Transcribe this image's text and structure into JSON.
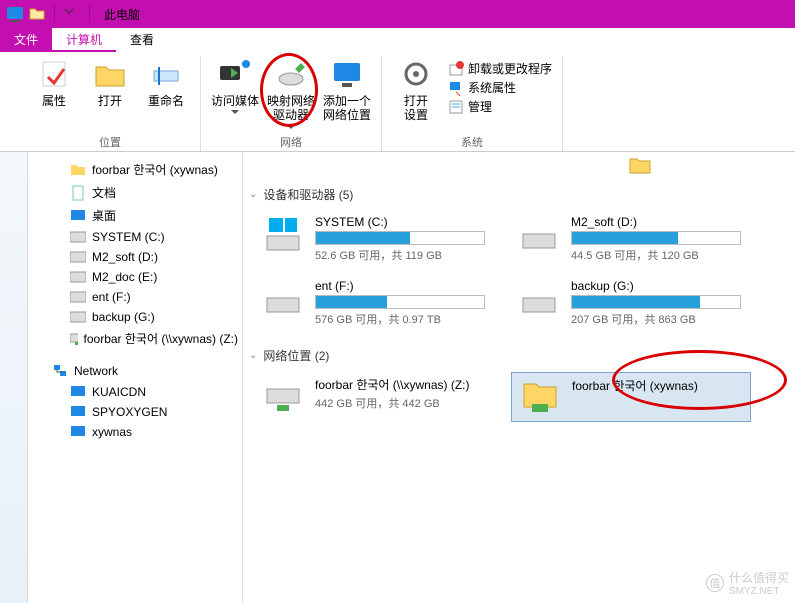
{
  "title": "此电脑",
  "tabs": {
    "file": "文件",
    "computer": "计算机",
    "view": "查看"
  },
  "ribbon": {
    "grp_location": "位置",
    "grp_network": "网络",
    "grp_system": "系统",
    "props": "属性",
    "open": "打开",
    "rename": "重命名",
    "access_media": "访问媒体",
    "map_drive_l1": "映射网络",
    "map_drive_l2": "驱动器",
    "add_loc_l1": "添加一个",
    "add_loc_l2": "网络位置",
    "open_settings_l1": "打开",
    "open_settings_l2": "设置",
    "uninstall": "卸载或更改程序",
    "sysprops": "系统属性",
    "manage": "管理"
  },
  "tree": {
    "foorbar": "foorbar 한국어 (xywnas)",
    "documents": "文档",
    "desktop": "桌面",
    "sysc": "SYSTEM (C:)",
    "m2soft": "M2_soft (D:)",
    "m2doc": "M2_doc (E:)",
    "entf": "ent (F:)",
    "backupg": "backup (G:)",
    "foorbarz": "foorbar 한국어 (\\\\xywnas) (Z:)",
    "network": "Network",
    "kuai": "KUAICDN",
    "spy": "SPYOXYGEN",
    "xywnas": "xywnas"
  },
  "main": {
    "devices_header": "设备和驱动器 (5)",
    "netloc_header": "网络位置 (2)",
    "drives": [
      {
        "name": "SYSTEM (C:)",
        "stat": "52.6 GB 可用，共 119 GB",
        "fill": 56
      },
      {
        "name": "M2_soft (D:)",
        "stat": "44.5 GB 可用，共 120 GB",
        "fill": 63
      },
      {
        "name": "ent (F:)",
        "stat": "576 GB 可用，共 0.97 TB",
        "fill": 42
      },
      {
        "name": "backup (G:)",
        "stat": "207 GB 可用，共 863 GB",
        "fill": 76
      }
    ],
    "netlocs": [
      {
        "name": "foorbar 한국어 (\\\\xywnas) (Z:)",
        "stat": "442 GB 可用，共 442 GB"
      },
      {
        "name": "foorbar 한국어 (xywnas)"
      }
    ]
  },
  "watermark": "什么值得买",
  "watermark_site": "SMYZ.NET"
}
